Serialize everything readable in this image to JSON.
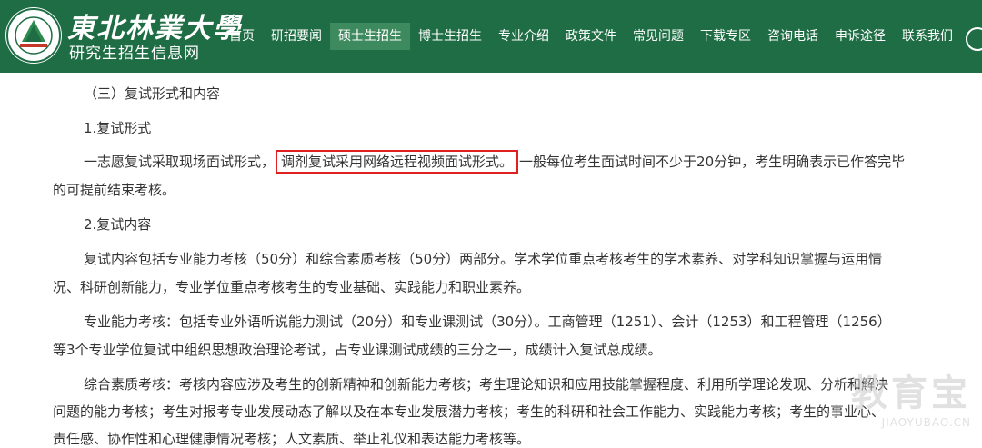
{
  "header": {
    "brand_name": "東北林業大學",
    "brand_sub": "研究生招生信息网",
    "colors": {
      "bar": "#1e6d44",
      "active": "#3d8a5e"
    }
  },
  "nav": {
    "items": [
      {
        "label": "首页"
      },
      {
        "label": "研招要闻"
      },
      {
        "label": "硕士生招生",
        "active": true
      },
      {
        "label": "博士生招生"
      },
      {
        "label": "专业介绍"
      },
      {
        "label": "政策文件"
      },
      {
        "label": "常见问题"
      },
      {
        "label": "下载专区"
      },
      {
        "label": "咨询电话"
      },
      {
        "label": "申诉途径"
      },
      {
        "label": "联系我们"
      }
    ]
  },
  "article": {
    "section_heading": "（三）复试形式和内容",
    "form_heading": "1.复试形式",
    "form_line1_a": "一志愿复试采取现场面试形式，",
    "form_line1_highlight": "调剂复试采用网络远程视频面试形式。",
    "form_line1_b": "一般每位考生面试时间不少于20分钟，考生明确表示已作答完毕",
    "form_line2": "的可提前结束考核。",
    "content_heading": "2.复试内容",
    "content_p1_line1": "复试内容包括专业能力考核（50分）和综合素质考核（50分）两部分。学术学位重点考核考生的学术素养、对学科知识掌握与运用情",
    "content_p1_line2": "况、科研创新能力，专业学位重点考核考生的专业基础、实践能力和职业素养。",
    "content_p2_line1": "专业能力考核：包括专业外语听说能力测试（20分）和专业课测试（30分）。工商管理（1251）、会计（1253）和工程管理（1256）",
    "content_p2_line2": "等3个专业学位复试中组织思想政治理论考试，占专业课测试成绩的三分之一，成绩计入复试总成绩。",
    "content_p3_line1": "综合素质考核：考核内容应涉及考生的创新精神和创新能力考核；考生理论知识和应用技能掌握程度、利用所学理论发现、分析和解决",
    "content_p3_line2": "问题的能力考核；考生对报考专业发展动态了解以及在本专业发展潜力考核；考生的科研和社会工作能力、实践能力考核；考生的事业心、",
    "content_p3_line3": "责任感、协作性和心理健康情况考核；人文素质、举止礼仪和表达能力考核等。"
  },
  "watermark": {
    "main": "教育宝",
    "sub": "JIAOYUBAO.CN"
  }
}
